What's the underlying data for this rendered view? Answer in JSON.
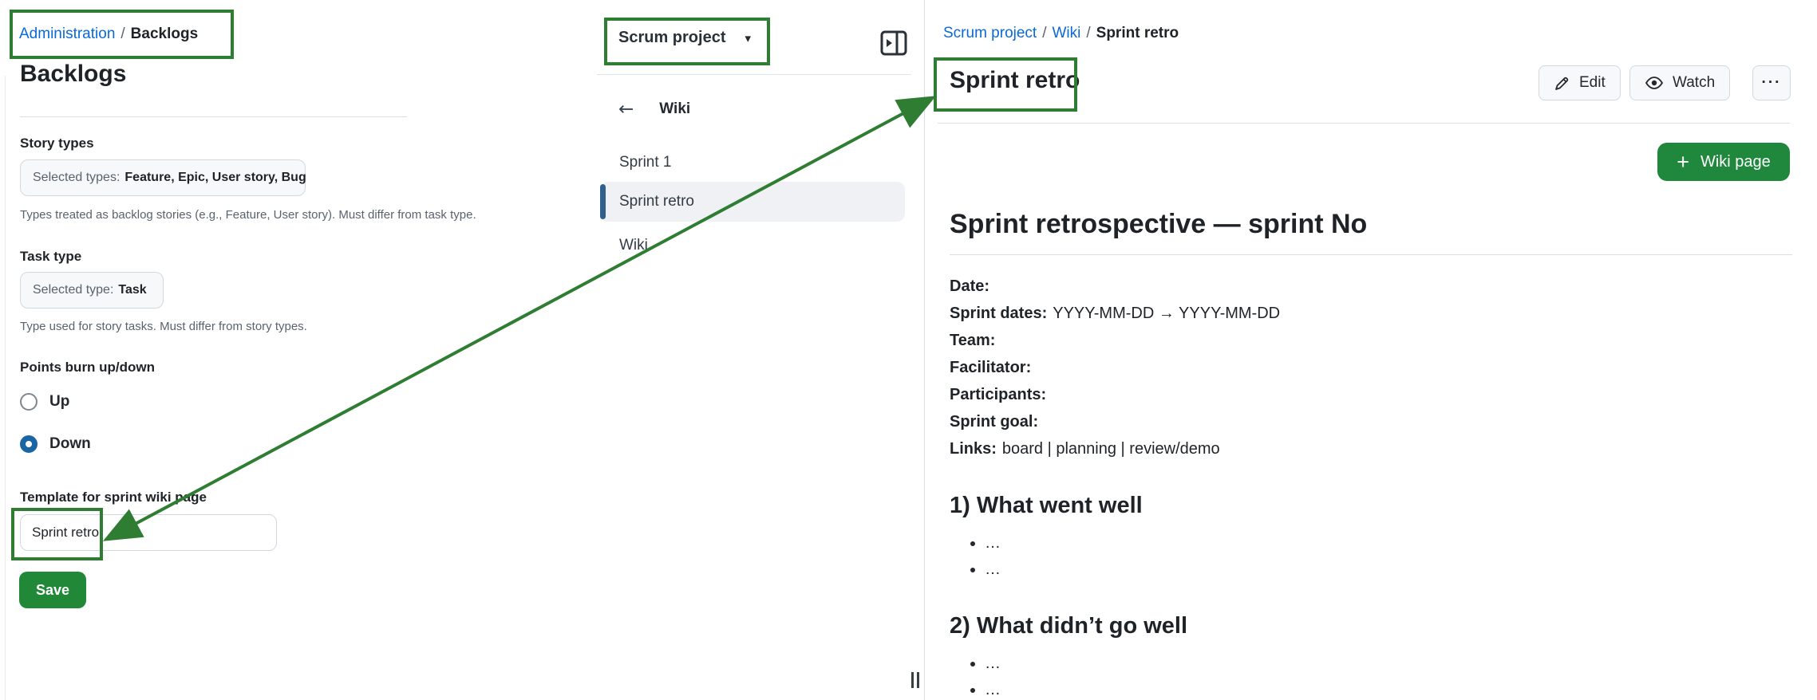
{
  "annotation_color": "#2e7d32",
  "admin_panel": {
    "breadcrumb": {
      "link": "Administration",
      "separator": "/",
      "current": "Backlogs"
    },
    "title": "Backlogs",
    "story_types": {
      "label": "Story types",
      "value_prefix": "Selected types:",
      "value": "Feature, Epic, User story, Bug",
      "help": "Types treated as backlog stories (e.g., Feature, User story). Must differ from task type."
    },
    "task_type": {
      "label": "Task type",
      "value_prefix": "Selected type:",
      "value": "Task",
      "help": "Type used for story tasks. Must differ from story types."
    },
    "points_burn": {
      "label": "Points burn up/down",
      "options": [
        {
          "label": "Up",
          "selected": false
        },
        {
          "label": "Down",
          "selected": true
        }
      ]
    },
    "template_field": {
      "label": "Template for sprint wiki page",
      "value": "Sprint retro"
    },
    "save_label": "Save"
  },
  "project_menu": {
    "name": "Scrum project"
  },
  "wiki_sidebar": {
    "back_title": "Wiki",
    "items": [
      {
        "label": "Sprint 1",
        "selected": false
      },
      {
        "label": "Sprint retro",
        "selected": true
      },
      {
        "label": "Wiki",
        "selected": false
      }
    ]
  },
  "wiki_page": {
    "breadcrumb": {
      "project": "Scrum project",
      "separator": "/",
      "section": "Wiki",
      "current": "Sprint retro"
    },
    "title": "Sprint retro",
    "actions": {
      "edit": "Edit",
      "watch": "Watch",
      "more": "···"
    },
    "new_page_label": "Wiki page",
    "content": {
      "heading": "Sprint retrospective — sprint No",
      "meta": [
        {
          "label": "Date:",
          "value": ""
        },
        {
          "label": "Sprint dates:",
          "value": "YYYY-MM-DD → YYYY-MM-DD"
        },
        {
          "label": "Team:",
          "value": ""
        },
        {
          "label": "Facilitator:",
          "value": ""
        },
        {
          "label": "Participants:",
          "value": ""
        },
        {
          "label": "Sprint goal:",
          "value": ""
        },
        {
          "label": "Links:",
          "value": "board | planning | review/demo"
        }
      ],
      "sections": [
        {
          "heading": "1) What went well",
          "bullets": [
            "…",
            "…"
          ]
        },
        {
          "heading": "2) What didn’t go well",
          "bullets": [
            "…",
            "…"
          ]
        }
      ]
    }
  },
  "icons": {
    "back_arrow": "←",
    "caret": "▾",
    "plus": "+"
  }
}
